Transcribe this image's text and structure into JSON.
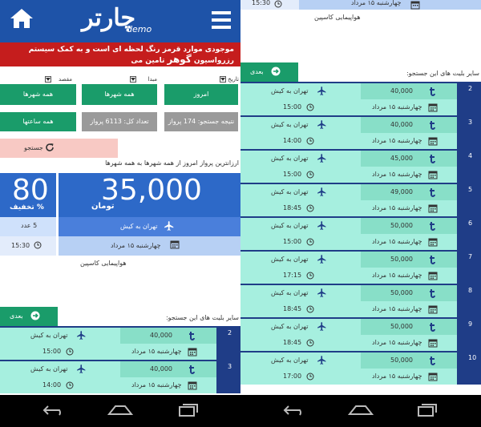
{
  "app": {
    "title": "چارتر",
    "sub": "demo"
  },
  "header": {
    "marquee_text": "موجودی موارد قرمز رنگ لحظه ای است و به کمک سیستم رزرواسیون",
    "marquee_brand": "گوهر",
    "marquee_end": "تامین می",
    "date_label": "تاریخ",
    "origin_label": "مبدا",
    "dest_label": "مقصد"
  },
  "filters": {
    "today": "امروز",
    "all_cities_origin": "همه شهرها",
    "all_cities_dest": "همه شهرها",
    "result_count": "نتیجه جستجو: 174 پرواز",
    "total_count": "تعداد کل: 6113 پرواز",
    "all_times": "همه ساعتها",
    "search": "جستجو"
  },
  "cheapest": {
    "caption": "ارزانترین پرواز امروز از همه شهرها به همه شهرها",
    "price": "35,000",
    "currency": "تومان",
    "discount_value": "80",
    "discount_label": "% تخفیف",
    "count": "5 عدد",
    "route": "تهران به کیش",
    "time": "15:30",
    "date": "چهارشنبه ۱۵ مرداد",
    "airline": "هواپیمایی کاسپین"
  },
  "more": {
    "title": "سایر بلیت های این جستجو:",
    "next": "بعدی"
  },
  "top_right": {
    "date": "چهارشنبه ۱۵ مرداد",
    "time": "15:30",
    "airline": "هواپیمایی کاسپین"
  },
  "flights": [
    {
      "n": "2",
      "price": "40,000",
      "route": "تهران به کیش",
      "date": "چهارشنبه ۱۵ مرداد",
      "time": "15:00"
    },
    {
      "n": "3",
      "price": "40,000",
      "route": "تهران به کیش",
      "date": "چهارشنبه ۱۵ مرداد",
      "time": "14:00"
    },
    {
      "n": "4",
      "price": "45,000",
      "route": "تهران به کیش",
      "date": "چهارشنبه ۱۵ مرداد",
      "time": "15:00"
    },
    {
      "n": "5",
      "price": "49,000",
      "route": "تهران به کیش",
      "date": "چهارشنبه ۱۵ مرداد",
      "time": "18:45"
    },
    {
      "n": "6",
      "price": "50,000",
      "route": "تهران به کیش",
      "date": "چهارشنبه ۱۵ مرداد",
      "time": "15:00"
    },
    {
      "n": "7",
      "price": "50,000",
      "route": "تهران به کیش",
      "date": "چهارشنبه ۱۵ مرداد",
      "time": "17:15"
    },
    {
      "n": "8",
      "price": "50,000",
      "route": "تهران به کیش",
      "date": "چهارشنبه ۱۵ مرداد",
      "time": "18:45"
    },
    {
      "n": "9",
      "price": "50,000",
      "route": "تهران به کیش",
      "date": "چهارشنبه ۱۵ مرداد",
      "time": "18:45"
    },
    {
      "n": "10",
      "price": "50,000",
      "route": "تهران به کیش",
      "date": "چهارشنبه ۱۵ مرداد",
      "time": "17:00"
    }
  ],
  "icons": {
    "home": "home-icon",
    "menu": "hamburger-menu-icon",
    "plane": "airplane-icon",
    "calendar": "calendar-icon",
    "clock": "clock-icon",
    "toman": "toman-icon",
    "refresh": "refresh-icon",
    "next": "arrow-right-circle-icon",
    "back": "back-arrow-icon",
    "nav_home": "nav-home-icon",
    "recents": "recent-apps-icon"
  },
  "colors": {
    "header_blue": "#1e53a8",
    "banner_red": "#c51d1d",
    "accent_green": "#1a9c6a",
    "card_blue": "#2d69c8",
    "row_teal": "#a6efdf",
    "index_navy": "#1f3d87"
  }
}
